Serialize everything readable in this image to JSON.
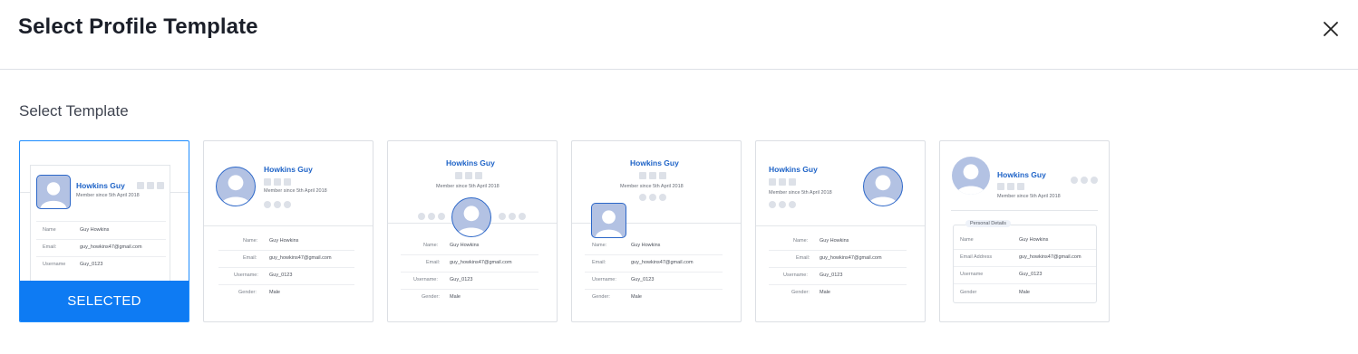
{
  "dialog": {
    "title": "Select Profile Template"
  },
  "section": {
    "label": "Select Template"
  },
  "selected_label": "SELECTED",
  "profile": {
    "name": "Howkins Guy",
    "member_since": "Member since 5th April 2018",
    "rows": [
      {
        "label": "Name:",
        "value": "Guy Howkins"
      },
      {
        "label": "Email:",
        "value": "guy_howkins47@gmail.com"
      },
      {
        "label": "Username:",
        "value": "Guy_0123"
      },
      {
        "label": "Gender:",
        "value": "Male"
      }
    ],
    "t1_rows": [
      {
        "label": "Name",
        "value": "Guy Howkins"
      },
      {
        "label": "Email:",
        "value": "guy_howkins47@gmail.com"
      },
      {
        "label": "Username",
        "value": "Guy_0123"
      }
    ],
    "t6_rows": [
      {
        "label": "Name",
        "value": "Guy Howkins"
      },
      {
        "label": "Email Address",
        "value": "guy_howkins47@gmail.com"
      },
      {
        "label": "Username",
        "value": "Guy_0123"
      },
      {
        "label": "Gender",
        "value": "Male"
      }
    ],
    "personal_details": "Personal Details"
  },
  "templates": [
    {
      "id": 1,
      "selected": true
    },
    {
      "id": 2,
      "selected": false
    },
    {
      "id": 3,
      "selected": false
    },
    {
      "id": 4,
      "selected": false
    },
    {
      "id": 5,
      "selected": false
    },
    {
      "id": 6,
      "selected": false
    }
  ],
  "colors": {
    "accent": "#0e7bf3",
    "name": "#1e63c7",
    "avatar": "#b3c2e3"
  },
  "icons": {
    "close": "close-icon",
    "avatar": "user-avatar-icon",
    "social": "social-icon"
  }
}
